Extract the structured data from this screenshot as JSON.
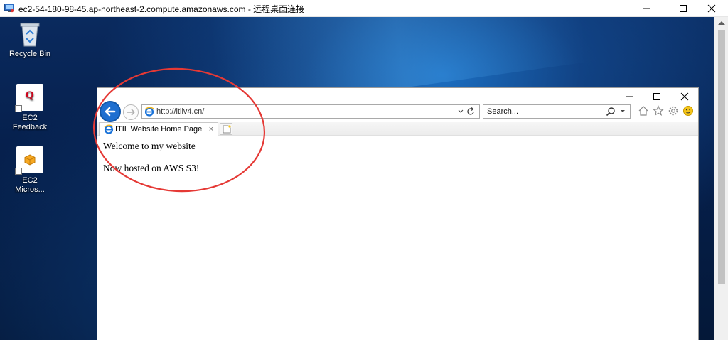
{
  "rdp_window": {
    "title": "ec2-54-180-98-45.ap-northeast-2.compute.amazonaws.com - 远程桌面连接"
  },
  "desktop": {
    "icons": [
      {
        "label": "Recycle Bin",
        "icon": "recycle-bin-icon"
      },
      {
        "label": "EC2 Feedback",
        "icon": "ec2-feedback-icon"
      },
      {
        "label": "EC2 Micros...",
        "icon": "ec2-microsoft-icon"
      }
    ]
  },
  "browser": {
    "address_url": "http://itilv4.cn/",
    "search_placeholder": "Search...",
    "tab_title": "ITIL Website Home Page",
    "tab_close": "×",
    "page": {
      "heading": "Welcome to my website",
      "line2": "Now hosted on AWS S3!"
    },
    "toolbar_icons": [
      "home-icon",
      "favorites-star-icon",
      "settings-gear-icon",
      "feedback-smiley-icon"
    ]
  },
  "colors": {
    "annotation": "#e53935",
    "ie_blue": "#1e6fd0"
  }
}
